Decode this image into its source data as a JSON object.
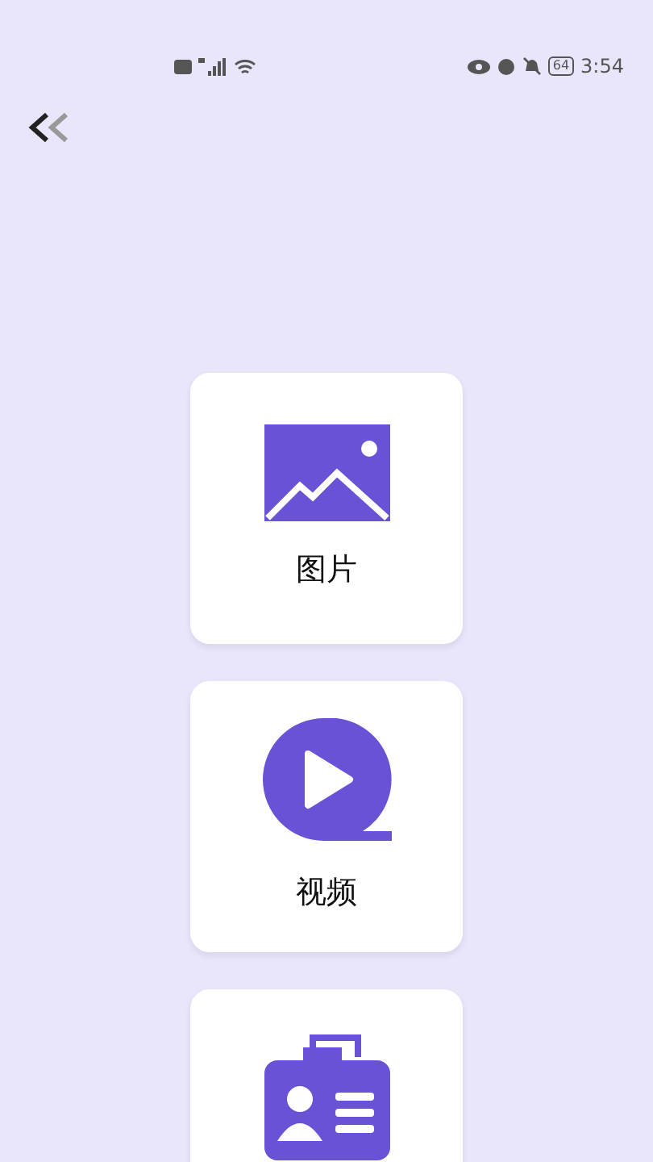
{
  "status_bar": {
    "battery": "64",
    "time": "3:54"
  },
  "items": [
    {
      "kind": "image",
      "label": "图片"
    },
    {
      "kind": "video",
      "label": "视频"
    },
    {
      "kind": "id-card"
    }
  ]
}
